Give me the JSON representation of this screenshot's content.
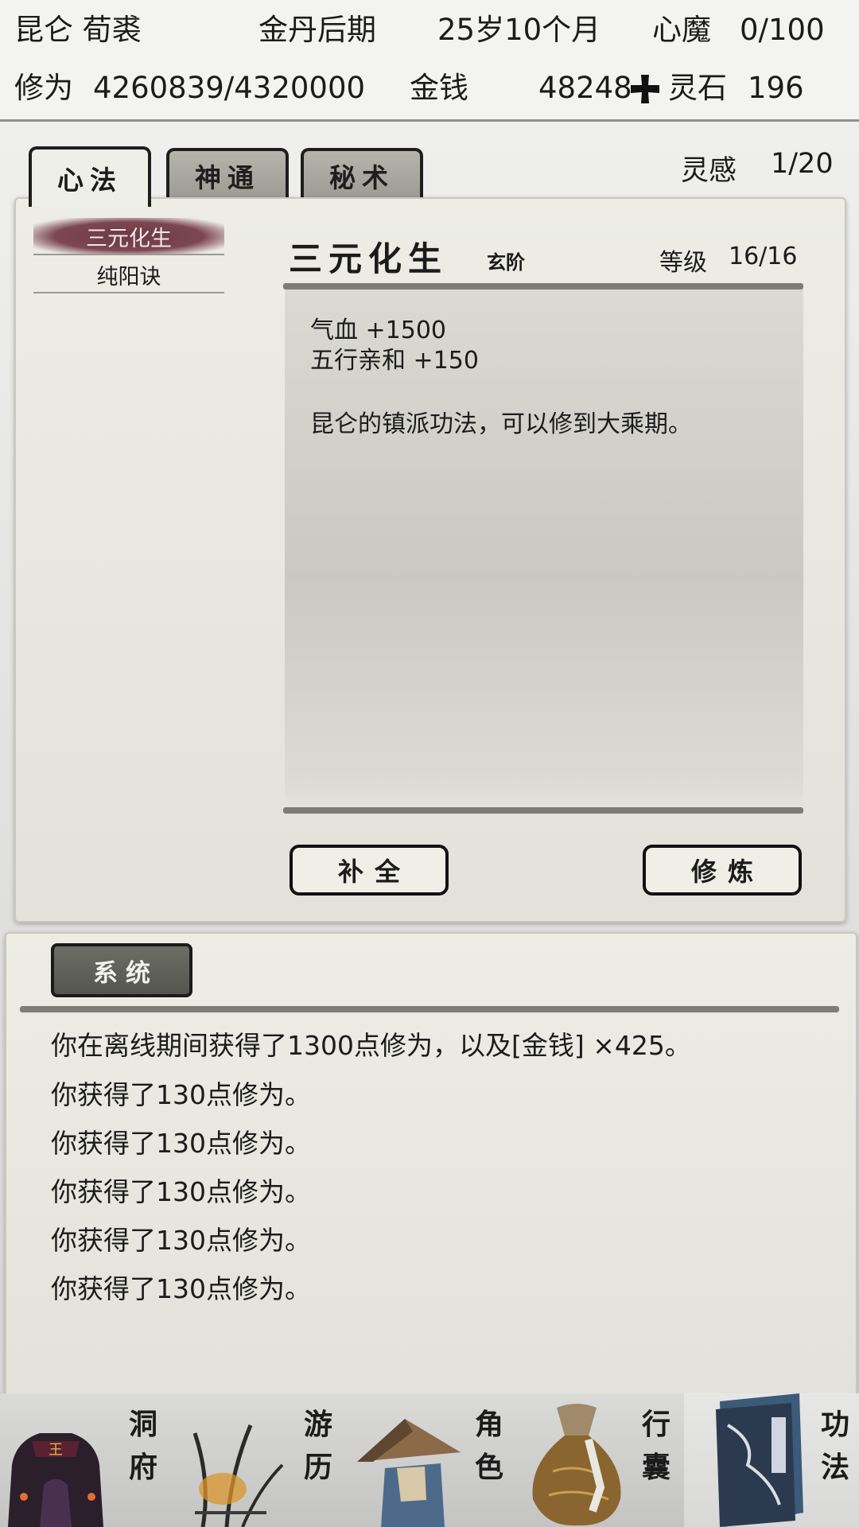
{
  "header": {
    "sect_name": "昆仑 荀裘",
    "realm": "金丹后期",
    "age": "25岁10个月",
    "demon_label": "心魔",
    "demon_value": "0/100",
    "cultivation_label": "修为",
    "cultivation_value": "4260839/4320000",
    "money_label": "金钱",
    "money_value": "48248",
    "spirit_stone_label": "灵石",
    "spirit_stone_value": "196"
  },
  "tabs": [
    {
      "label": "心法",
      "active": true
    },
    {
      "label": "神通",
      "active": false
    },
    {
      "label": "秘术",
      "active": false
    }
  ],
  "inspiration": {
    "label": "灵感",
    "value": "1/20"
  },
  "technique_list": [
    {
      "name": "三元化生",
      "selected": true
    },
    {
      "name": "纯阳诀",
      "selected": false
    }
  ],
  "detail": {
    "title": "三元化生",
    "grade": "玄阶",
    "level_label": "等级",
    "level_value": "16/16",
    "stats": [
      "气血 +1500",
      "五行亲和 +150"
    ],
    "description": "昆仑的镇派功法，可以修到大乘期。",
    "button_complete": "补全",
    "button_cultivate": "修炼"
  },
  "log": {
    "tab_label": "系统",
    "lines": [
      "你在离线期间获得了1300点修为，以及[金钱] ×425。",
      "你获得了130点修为。",
      "你获得了130点修为。",
      "你获得了130点修为。",
      "你获得了130点修为。",
      "你获得了130点修为。"
    ]
  },
  "bottom_nav": [
    {
      "label_top": "洞",
      "label_bottom": "府",
      "icon": "cave-dwelling-icon"
    },
    {
      "label_top": "游",
      "label_bottom": "历",
      "icon": "travel-reed-icon"
    },
    {
      "label_top": "角",
      "label_bottom": "色",
      "icon": "bamboo-hat-icon"
    },
    {
      "label_top": "行",
      "label_bottom": "囊",
      "icon": "cloth-bag-icon"
    },
    {
      "label_top": "功",
      "label_bottom": "法",
      "icon": "scripture-book-icon"
    }
  ]
}
